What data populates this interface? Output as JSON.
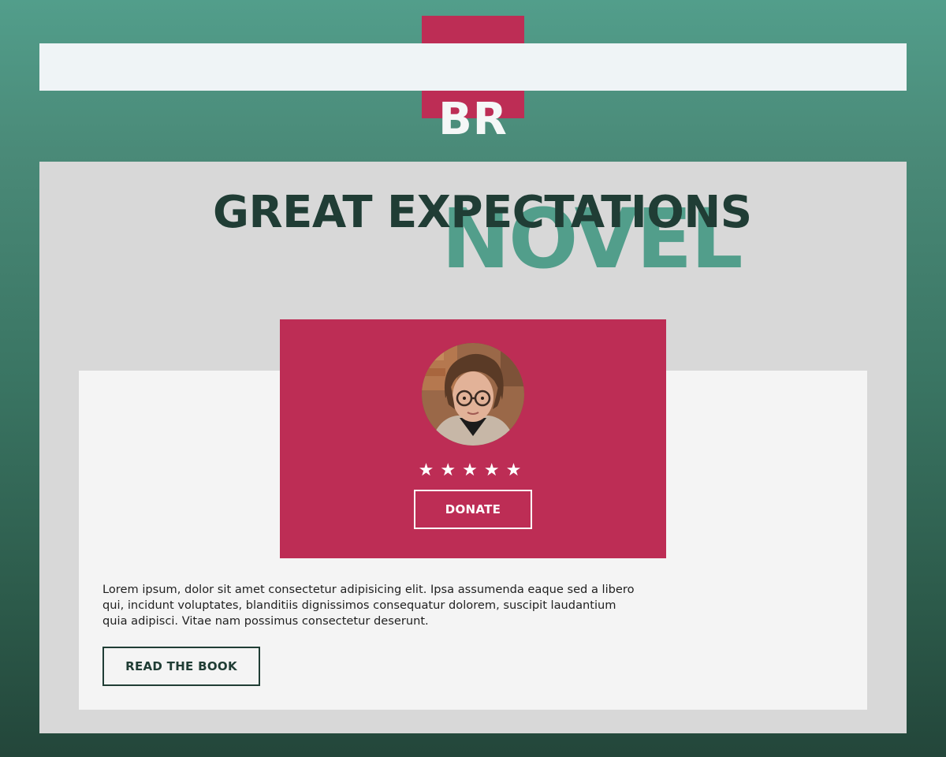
{
  "header": {
    "logo_text": "BR"
  },
  "hero": {
    "title": "GREAT EXPECTATIONS",
    "subtitle": "NOVEL"
  },
  "profile": {
    "rating_stars": 5,
    "star_glyph": "★",
    "donate_label": "DONATE"
  },
  "content": {
    "description": "Lorem ipsum, dolor sit amet consectetur adipisicing elit. Ipsa assumenda eaque sed a libero qui, incidunt voluptates, blanditiis dignissimos consequatur dolorem, suscipit laudantium quia adipisci. Vitae nam possimus consectetur deserunt.",
    "read_label": "READ THE BOOK"
  },
  "colors": {
    "accent_green": "#529e8b",
    "dark_green": "#203d35",
    "brand_pink": "#bd2d55",
    "panel_gray": "#d8d8d8",
    "card_white": "#f4f4f4"
  }
}
